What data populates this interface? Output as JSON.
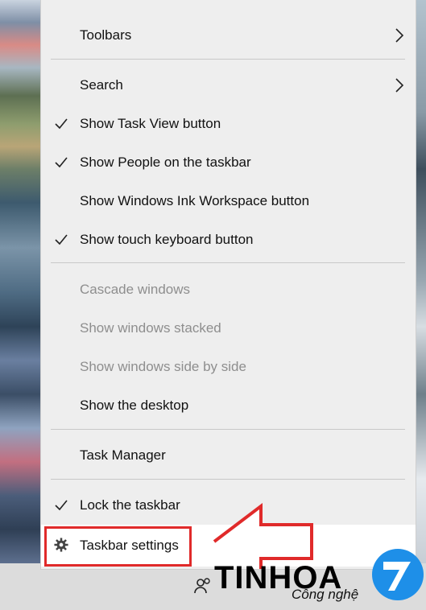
{
  "menu": {
    "items": [
      {
        "label": "Toolbars",
        "checked": false,
        "submenu": true,
        "disabled": false
      },
      {
        "label": "Search",
        "checked": false,
        "submenu": true,
        "disabled": false
      },
      {
        "label": "Show Task View button",
        "checked": true,
        "submenu": false,
        "disabled": false
      },
      {
        "label": "Show People on the taskbar",
        "checked": true,
        "submenu": false,
        "disabled": false
      },
      {
        "label": "Show Windows Ink Workspace button",
        "checked": false,
        "submenu": false,
        "disabled": false
      },
      {
        "label": "Show touch keyboard button",
        "checked": true,
        "submenu": false,
        "disabled": false
      },
      {
        "label": "Cascade windows",
        "checked": false,
        "submenu": false,
        "disabled": true
      },
      {
        "label": "Show windows stacked",
        "checked": false,
        "submenu": false,
        "disabled": true
      },
      {
        "label": "Show windows side by side",
        "checked": false,
        "submenu": false,
        "disabled": true
      },
      {
        "label": "Show the desktop",
        "checked": false,
        "submenu": false,
        "disabled": false
      },
      {
        "label": "Task Manager",
        "checked": false,
        "submenu": false,
        "disabled": false
      },
      {
        "label": "Lock the taskbar",
        "checked": true,
        "submenu": false,
        "disabled": false
      },
      {
        "label": "Taskbar settings",
        "checked": false,
        "submenu": false,
        "disabled": false,
        "icon": "gear-icon"
      }
    ]
  },
  "watermark": {
    "brand": "TINHOA",
    "subtitle": "Công nghệ",
    "logo_glyph": "7"
  },
  "colors": {
    "highlight": "#e02a2a",
    "menu_bg": "#eeeeee",
    "disabled_text": "#8e8e8e",
    "logo_blue": "#1e8fe8"
  },
  "taskbar": {
    "people_icon": "people-icon"
  }
}
